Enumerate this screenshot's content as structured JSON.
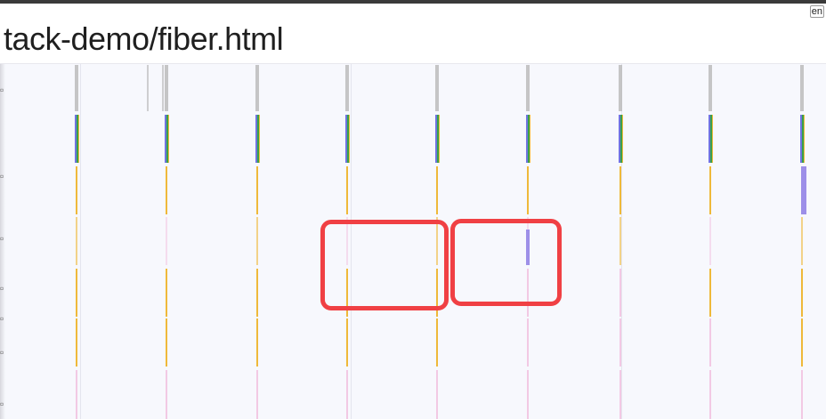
{
  "header": {
    "url_text": "tack-demo/fiber.html",
    "locale_badge": "en"
  },
  "colors": {
    "background": "#f7f8fd",
    "marker_gray": "#bcbcbc",
    "marker_green": "#3aa04a",
    "marker_blue": "#6f74e0",
    "marker_orange": "#efb93a",
    "marker_purple": "#9d8fe8",
    "marker_pink": "#f2c9e4",
    "highlight_red": "#f04044"
  },
  "timeline": {
    "rows": [
      "gray",
      "multi",
      "orange",
      "orange-faint",
      "orange-pink",
      "orange-pink",
      "pink"
    ]
  },
  "annotations": [
    "highlight-box-1",
    "highlight-box-2"
  ]
}
